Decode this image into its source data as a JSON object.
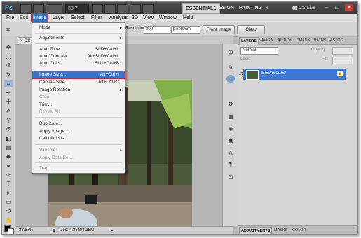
{
  "titlebar": {
    "app_logo": "Ps",
    "zoom": "38.7",
    "workspaces": [
      "ESSENTIALS",
      "DESIGN",
      "PAINTING",
      "»"
    ],
    "cs_live": "CS Live",
    "window_controls": [
      "–",
      "□",
      "✕"
    ]
  },
  "menubar": [
    "File",
    "Edit",
    "Image",
    "Layer",
    "Select",
    "Filter",
    "Analysis",
    "3D",
    "View",
    "Window",
    "Help"
  ],
  "options_bar": {
    "resolution_label": "Resolution:",
    "resolution_value": "300",
    "resolution_unit": "pixels/cm",
    "front_image_button": "Front Image",
    "clear_button": "Clear"
  },
  "document": {
    "tab_label": "DS",
    "zoom_status": "38.67%",
    "doc_info": "Doc: 4.35M/4.35M"
  },
  "image_menu": {
    "items": [
      {
        "label": "Mode",
        "submenu": true
      },
      {
        "separator": true
      },
      {
        "label": "Adjustments",
        "submenu": true
      },
      {
        "separator": true
      },
      {
        "label": "Auto Tone",
        "shortcut": "Shift+Ctrl+L"
      },
      {
        "label": "Auto Contrast",
        "shortcut": "Alt+Shift+Ctrl+L"
      },
      {
        "label": "Auto Color",
        "shortcut": "Shift+Ctrl+B"
      },
      {
        "separator": true
      },
      {
        "label": "Image Size...",
        "shortcut": "Alt+Ctrl+I",
        "selected": true
      },
      {
        "label": "Canvas Size...",
        "shortcut": "Alt+Ctrl+C"
      },
      {
        "label": "Image Rotation",
        "submenu": true
      },
      {
        "label": "Crop",
        "disabled": true
      },
      {
        "label": "Trim..."
      },
      {
        "label": "Reveal All",
        "disabled": true
      },
      {
        "separator": true
      },
      {
        "label": "Duplicate..."
      },
      {
        "label": "Apply Image..."
      },
      {
        "label": "Calculations..."
      },
      {
        "separator": true
      },
      {
        "label": "Variables",
        "submenu": true,
        "disabled": true
      },
      {
        "label": "Apply Data Set...",
        "disabled": true
      },
      {
        "separator": true
      },
      {
        "label": "Trap...",
        "disabled": true
      }
    ]
  },
  "layers_panel": {
    "tabs": [
      "LAYERS",
      "NAVIGA",
      "ACTION",
      "CHANNI",
      "PATHS",
      "HISTOG"
    ],
    "blend_mode": "Normal",
    "opacity_label": "Opacity:",
    "lock_label": "Lock:",
    "fill_label": "Fill:",
    "layer_name": "Background",
    "bottom_tabs": [
      "ADJUSTMENTS",
      "MASKS",
      "COLOR"
    ]
  },
  "colors": {
    "menu_highlight": "#3a73c4",
    "selection_outline": "#d0242b",
    "layer_selected": "#3b78d6"
  }
}
